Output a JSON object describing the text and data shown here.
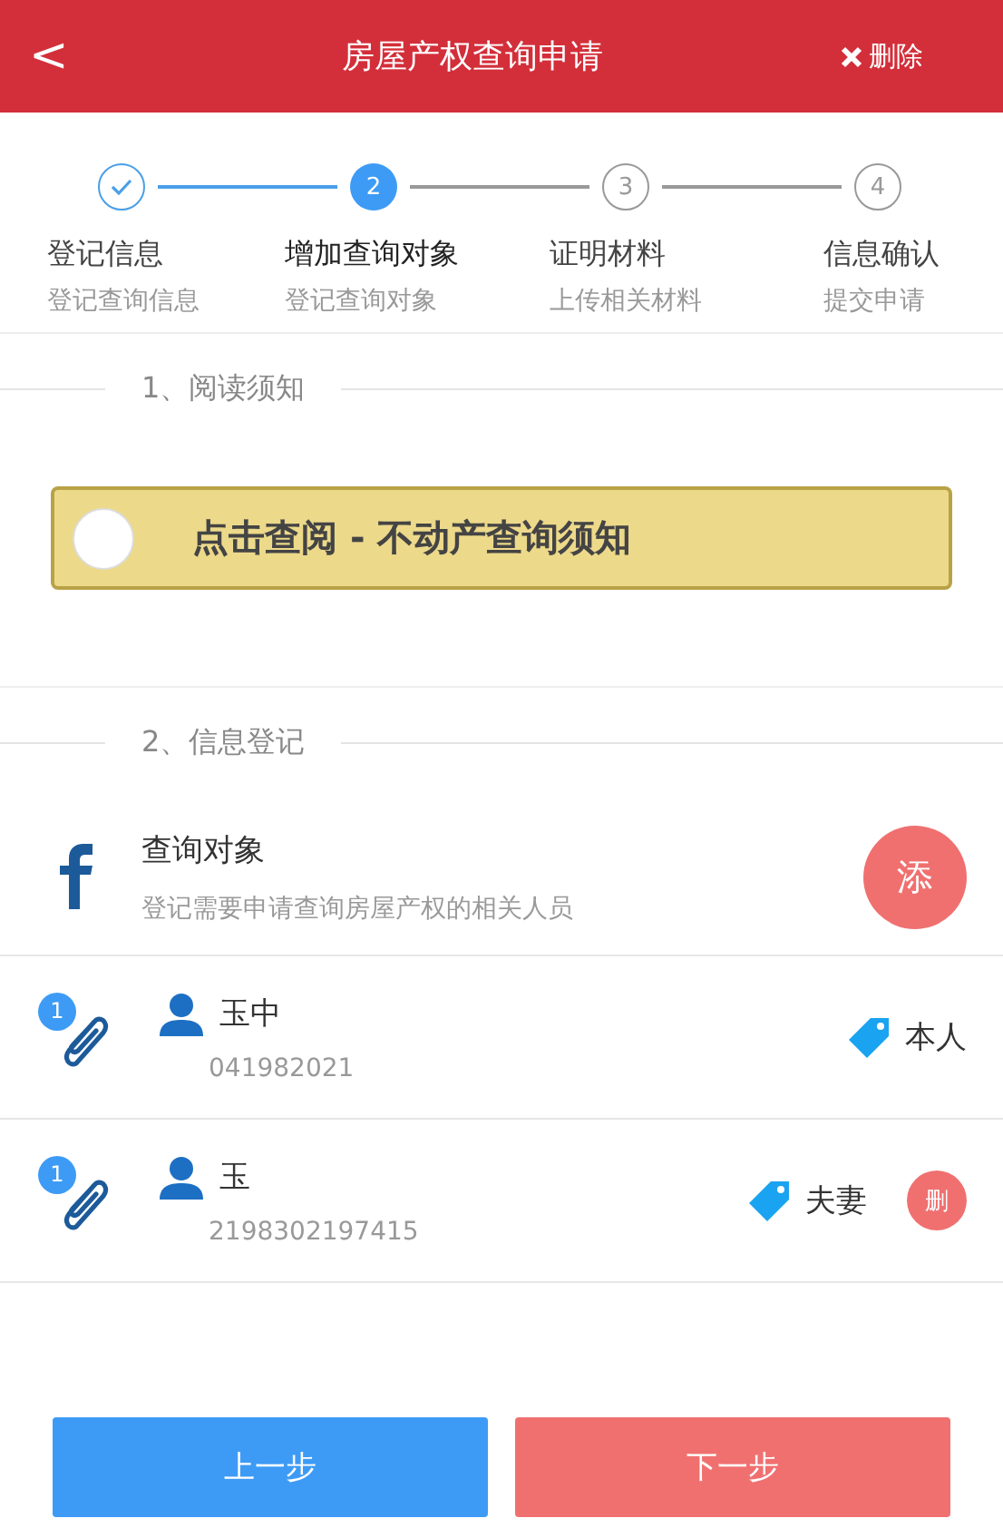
{
  "header": {
    "back_icon": "<",
    "title": "房屋产权查询申请",
    "delete_label": "删除"
  },
  "steps": [
    {
      "title": "登记信息",
      "subtitle": "登记查询信息",
      "completed": true,
      "selected": false
    },
    {
      "number": "2",
      "title": "增加查询对象",
      "subtitle": "登记查询对象",
      "completed": false,
      "selected": true
    },
    {
      "number": "3",
      "title": "证明材料",
      "subtitle": "上传相关材料",
      "completed": false,
      "selected": false
    },
    {
      "number": "4",
      "title": "信息确认",
      "subtitle": "提交申请",
      "completed": false,
      "selected": false
    }
  ],
  "section_1": {
    "title": "1、阅读须知",
    "notice_button": {
      "label": "点击查阅 - 不动产查询须知",
      "checked": false
    }
  },
  "section_2": {
    "title": "2、信息登记",
    "query_object": {
      "title": "查询对象",
      "description": "登记需要申请查询房屋产权的相关人员",
      "add_button": "添"
    },
    "persons": [
      {
        "attachments": "1",
        "name": "玉中",
        "id_number": "041982021",
        "relation": "本人"
      },
      {
        "attachments": "1",
        "name": "玉",
        "id_number": "2198302197415",
        "relation": "夫妻",
        "delete_button": "删"
      }
    ]
  },
  "buttons": [
    {
      "label": "上一步",
      "kind": "secondary"
    },
    {
      "label": "下一步",
      "kind": "primary"
    }
  ]
}
